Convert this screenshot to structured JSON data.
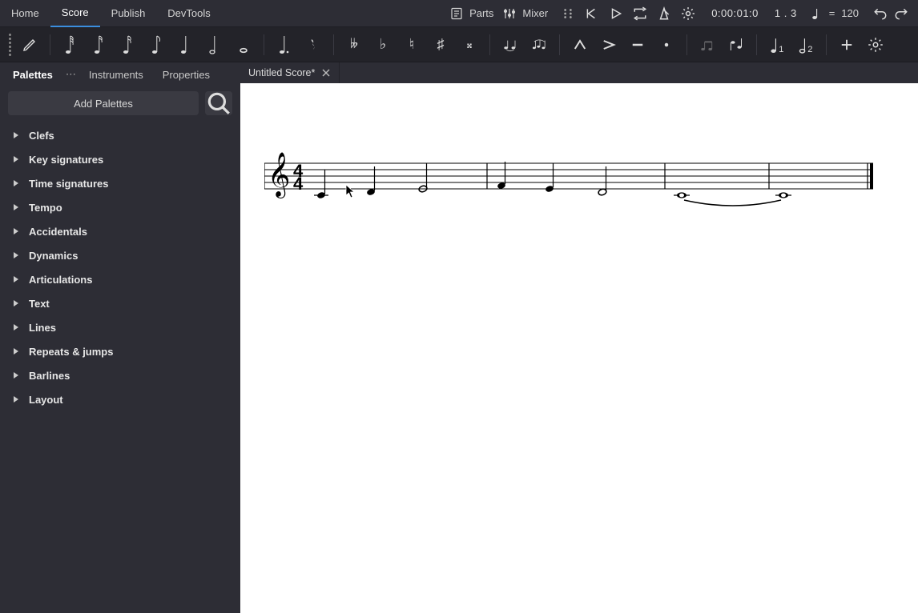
{
  "menu": {
    "tabs": [
      "Home",
      "Score",
      "Publish",
      "DevTools"
    ],
    "active": "Score",
    "parts_label": "Parts",
    "mixer_label": "Mixer",
    "time": "0:00:01:0",
    "beat": "1 . 3",
    "tempo_prefix": "= ",
    "tempo_value": "120"
  },
  "toolbar": {
    "note_durations": [
      "64th",
      "32nd",
      "16th",
      "8th",
      "quarter",
      "half",
      "whole"
    ],
    "dot_label": "augmentation-dot",
    "rest_label": "rest",
    "accidentals": [
      "double-flat",
      "flat",
      "natural",
      "sharp",
      "double-sharp"
    ],
    "ties": [
      "tie",
      "slur"
    ],
    "articulations": [
      "marcato",
      "accent",
      "tenuto",
      "staccato"
    ],
    "voices": [
      "1",
      "2"
    ]
  },
  "dock": {
    "tabs": [
      "Palettes",
      "Instruments",
      "Properties"
    ],
    "active": "Palettes"
  },
  "file_tab": {
    "title": "Untitled Score*"
  },
  "sidebar": {
    "add_palettes_label": "Add Palettes",
    "items": [
      "Clefs",
      "Key signatures",
      "Time signatures",
      "Tempo",
      "Accidentals",
      "Dynamics",
      "Articulations",
      "Text",
      "Lines",
      "Repeats & jumps",
      "Barlines",
      "Layout"
    ]
  },
  "score": {
    "clef": "treble",
    "time_signature": "4/4",
    "measures": 4,
    "notes": [
      {
        "measure": 1,
        "beats": [
          {
            "dur": "quarter",
            "pitch": "C4"
          },
          {
            "dur": "quarter",
            "pitch": "D4"
          },
          {
            "dur": "half",
            "pitch": "E4"
          }
        ]
      },
      {
        "measure": 2,
        "beats": [
          {
            "dur": "quarter",
            "pitch": "F4"
          },
          {
            "dur": "quarter",
            "pitch": "E4"
          },
          {
            "dur": "half",
            "pitch": "D4"
          }
        ]
      },
      {
        "measure": 3,
        "beats": [
          {
            "dur": "whole",
            "pitch": "C4",
            "tied": true
          }
        ]
      },
      {
        "measure": 4,
        "beats": [
          {
            "dur": "whole",
            "pitch": "C4"
          }
        ]
      }
    ]
  }
}
